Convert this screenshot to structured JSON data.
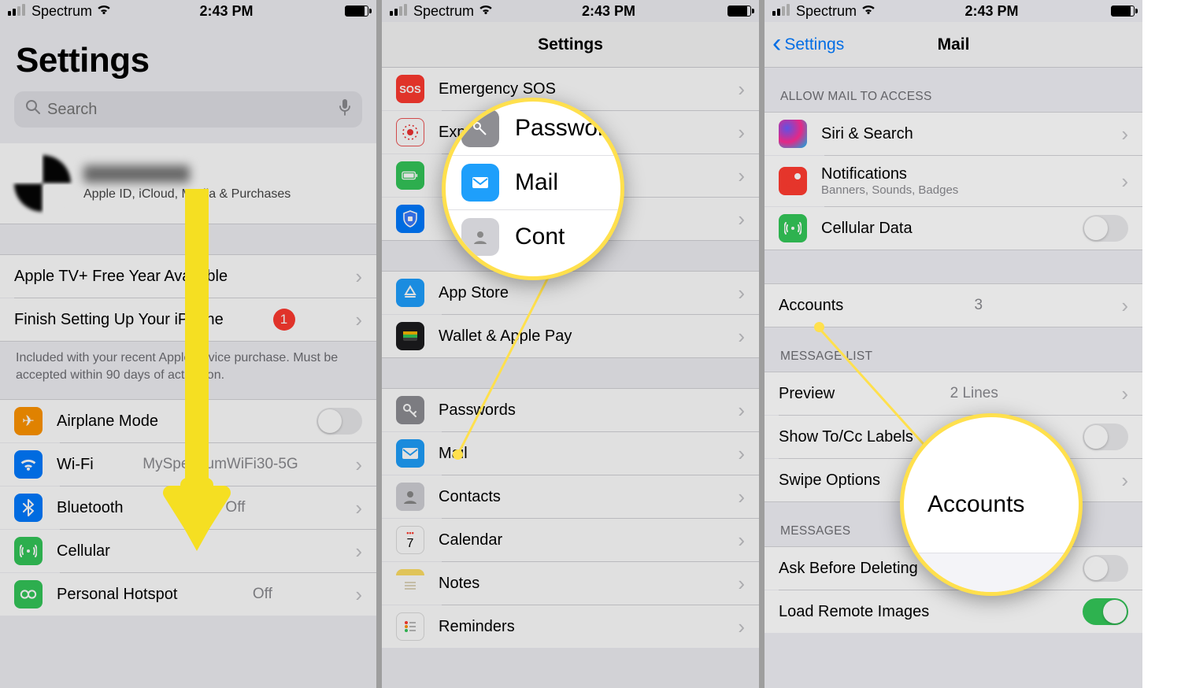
{
  "status": {
    "carrier": "Spectrum",
    "time": "2:43 PM"
  },
  "p1": {
    "title": "Settings",
    "search_placeholder": "Search",
    "profile_sub": "Apple ID, iCloud, Media & Purchases",
    "promo": "Apple TV+ Free Year Available",
    "finish": "Finish Setting Up Your iPhone",
    "finish_badge": "1",
    "note": "Included with your recent Apple device purchase. Must be accepted within 90 days of activation.",
    "airplane": "Airplane Mode",
    "wifi": "Wi-Fi",
    "wifi_value": "MySpectrumWiFi30-5G",
    "bt": "Bluetooth",
    "bt_value": "Off",
    "cellular": "Cellular",
    "hotspot": "Personal Hotspot",
    "hotspot_value": "Off"
  },
  "p2": {
    "title": "Settings",
    "items": {
      "sos": "Emergency SOS",
      "exposure": "Exposure Notifications",
      "battery": "Battery",
      "privacy": "Privacy",
      "appstore": "App Store",
      "wallet": "Wallet & Apple Pay",
      "passwords": "Passwords",
      "mail": "Mail",
      "contacts": "Contacts",
      "calendar": "Calendar",
      "notes": "Notes",
      "reminders": "Reminders"
    },
    "bubble": {
      "pass": "Passwords",
      "mail": "Mail",
      "cont": "Contacts"
    }
  },
  "p3": {
    "back": "Settings",
    "title": "Mail",
    "hdr_allow": "ALLOW MAIL TO ACCESS",
    "siri": "Siri & Search",
    "notif": "Notifications",
    "notif_sub": "Banners, Sounds, Badges",
    "cellular": "Cellular Data",
    "accounts": "Accounts",
    "accounts_value": "3",
    "hdr_msglist": "MESSAGE LIST",
    "preview": "Preview",
    "preview_value": "2 Lines",
    "tocc": "Show To/Cc Labels",
    "swipe": "Swipe Options",
    "hdr_msgs": "MESSAGES",
    "askdel": "Ask Before Deleting",
    "remote": "Load Remote Images",
    "bubble": "Accounts"
  }
}
